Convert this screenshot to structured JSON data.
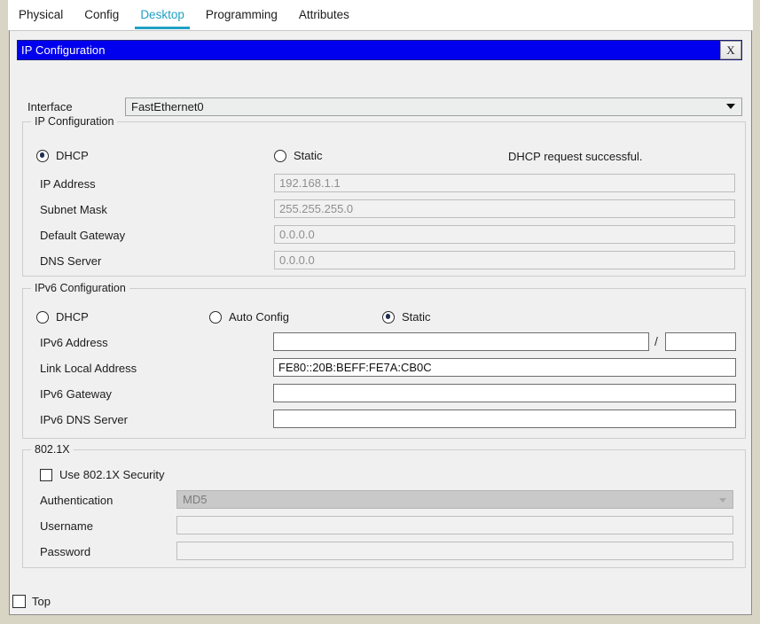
{
  "tabs": [
    {
      "label": "Physical",
      "active": false
    },
    {
      "label": "Config",
      "active": false
    },
    {
      "label": "Desktop",
      "active": true
    },
    {
      "label": "Programming",
      "active": false
    },
    {
      "label": "Attributes",
      "active": false
    }
  ],
  "dialog": {
    "title": "IP Configuration",
    "close_label": "X",
    "title_bar_color": "#0000ee",
    "accent_color": "#21a0c4"
  },
  "interface": {
    "label": "Interface",
    "value": "FastEthernet0",
    "arrow_icon": "chevron-down-icon"
  },
  "ipv4": {
    "legend": "IP Configuration",
    "dhcp_label": "DHCP",
    "dhcp_selected": true,
    "static_label": "Static",
    "static_selected": false,
    "status": "DHCP request successful.",
    "fields": [
      {
        "label": "IP Address",
        "value": "192.168.1.1",
        "enabled": false
      },
      {
        "label": "Subnet Mask",
        "value": "255.255.255.0",
        "enabled": false
      },
      {
        "label": "Default Gateway",
        "value": "0.0.0.0",
        "enabled": false
      },
      {
        "label": "DNS Server",
        "value": "0.0.0.0",
        "enabled": false
      }
    ]
  },
  "ipv6": {
    "legend": "IPv6 Configuration",
    "dhcp_label": "DHCP",
    "dhcp_selected": false,
    "auto_config_label": "Auto Config",
    "auto_config_selected": false,
    "static_label": "Static",
    "static_selected": true,
    "address_label": "IPv6 Address",
    "address_value": "",
    "prefix_separator": "/",
    "prefix_value": "",
    "link_local_label": "Link Local Address",
    "link_local_value": "FE80::20B:BEFF:FE7A:CB0C",
    "gateway_label": "IPv6 Gateway",
    "gateway_value": "",
    "dns_label": "IPv6 DNS Server",
    "dns_value": ""
  },
  "dot1x": {
    "legend": "802.1X",
    "use_security_label": "Use 802.1X Security",
    "use_security_checked": false,
    "auth_label": "Authentication",
    "auth_value": "MD5",
    "auth_enabled": false,
    "username_label": "Username",
    "username_value": "",
    "password_label": "Password",
    "password_value": ""
  },
  "footer": {
    "top_label": "Top",
    "top_checked": false
  }
}
